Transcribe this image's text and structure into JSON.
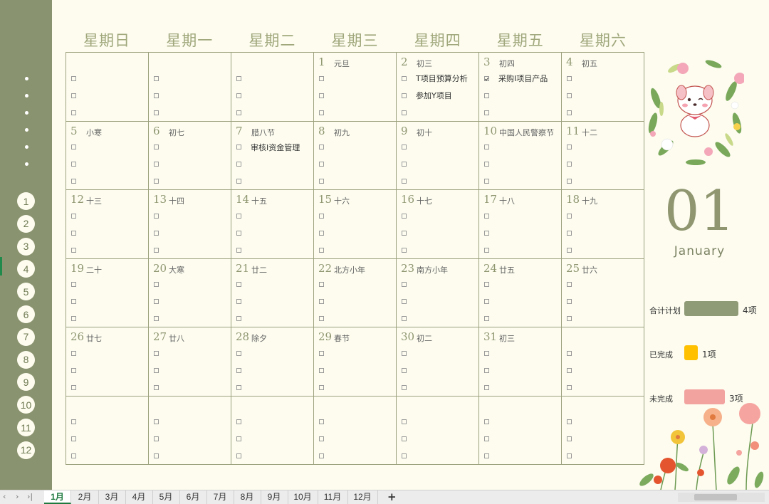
{
  "weekdays": [
    "星期日",
    "星期一",
    "星期二",
    "星期三",
    "星期四",
    "星期五",
    "星期六"
  ],
  "months_sidebar": [
    "1",
    "2",
    "3",
    "4",
    "5",
    "6",
    "7",
    "8",
    "9",
    "10",
    "11",
    "12"
  ],
  "calendar": {
    "cells": [
      {
        "day": "",
        "lunar": "",
        "tasks": []
      },
      {
        "day": "",
        "lunar": "",
        "tasks": []
      },
      {
        "day": "",
        "lunar": "",
        "tasks": []
      },
      {
        "day": "1",
        "lunar": "元旦",
        "tasks": []
      },
      {
        "day": "2",
        "lunar": "初三",
        "tasks": [
          {
            "text": "T项目预算分析",
            "checked": false
          },
          {
            "text": "参加Y项目",
            "checked": false
          }
        ]
      },
      {
        "day": "3",
        "lunar": "初四",
        "tasks": [
          {
            "text": "采购I项目产品",
            "checked": true
          }
        ]
      },
      {
        "day": "4",
        "lunar": "初五",
        "tasks": []
      },
      {
        "day": "5",
        "lunar": "小寒",
        "tasks": []
      },
      {
        "day": "6",
        "lunar": "初七",
        "tasks": []
      },
      {
        "day": "7",
        "lunar": "腊八节",
        "tasks": [
          {
            "text": "审核I资金管理",
            "checked": false
          }
        ]
      },
      {
        "day": "8",
        "lunar": "初九",
        "tasks": []
      },
      {
        "day": "9",
        "lunar": "初十",
        "tasks": []
      },
      {
        "day": "10",
        "lunar": "中国人民警察节",
        "tasks": []
      },
      {
        "day": "11",
        "lunar": "十二",
        "tasks": []
      },
      {
        "day": "12",
        "lunar": "十三",
        "tasks": []
      },
      {
        "day": "13",
        "lunar": "十四",
        "tasks": []
      },
      {
        "day": "14",
        "lunar": "十五",
        "tasks": []
      },
      {
        "day": "15",
        "lunar": "十六",
        "tasks": []
      },
      {
        "day": "16",
        "lunar": "十七",
        "tasks": []
      },
      {
        "day": "17",
        "lunar": "十八",
        "tasks": []
      },
      {
        "day": "18",
        "lunar": "十九",
        "tasks": []
      },
      {
        "day": "19",
        "lunar": "二十",
        "tasks": []
      },
      {
        "day": "20",
        "lunar": "大寒",
        "tasks": []
      },
      {
        "day": "21",
        "lunar": "廿二",
        "tasks": []
      },
      {
        "day": "22",
        "lunar": "北方小年",
        "tasks": []
      },
      {
        "day": "23",
        "lunar": "南方小年",
        "tasks": []
      },
      {
        "day": "24",
        "lunar": "廿五",
        "tasks": []
      },
      {
        "day": "25",
        "lunar": "廿六",
        "tasks": []
      },
      {
        "day": "26",
        "lunar": "廿七",
        "tasks": []
      },
      {
        "day": "27",
        "lunar": "廿八",
        "tasks": []
      },
      {
        "day": "28",
        "lunar": "除夕",
        "tasks": []
      },
      {
        "day": "29",
        "lunar": "春节",
        "tasks": []
      },
      {
        "day": "30",
        "lunar": "初二",
        "tasks": []
      },
      {
        "day": "31",
        "lunar": "初三",
        "tasks": []
      },
      {
        "day": "",
        "lunar": "",
        "tasks": []
      },
      {
        "day": "",
        "lunar": "",
        "tasks": []
      },
      {
        "day": "",
        "lunar": "",
        "tasks": []
      },
      {
        "day": "",
        "lunar": "",
        "tasks": []
      },
      {
        "day": "",
        "lunar": "",
        "tasks": []
      },
      {
        "day": "",
        "lunar": "",
        "tasks": []
      },
      {
        "day": "",
        "lunar": "",
        "tasks": []
      },
      {
        "day": "",
        "lunar": "",
        "tasks": []
      }
    ]
  },
  "month": {
    "number": "01",
    "name": "January"
  },
  "stats": {
    "total": {
      "label": "合计计划",
      "value": "4项",
      "fraction": 1.0,
      "color": "#8f9a76"
    },
    "done": {
      "label": "已完成",
      "value": "1项",
      "fraction": 0.25,
      "color": "#ffc000"
    },
    "todo": {
      "label": "未完成",
      "value": "3项",
      "fraction": 0.75,
      "color": "#f2a3a0"
    }
  },
  "sheet_tabs": [
    "1月",
    "2月",
    "3月",
    "4月",
    "5月",
    "6月",
    "7月",
    "8月",
    "9月",
    "10月",
    "11月",
    "12月"
  ],
  "active_tab": 0,
  "add_sheet_label": "+",
  "colors": {
    "sidebar": "#8a936f",
    "background": "#fdfcef",
    "accent": "#8f9670"
  }
}
